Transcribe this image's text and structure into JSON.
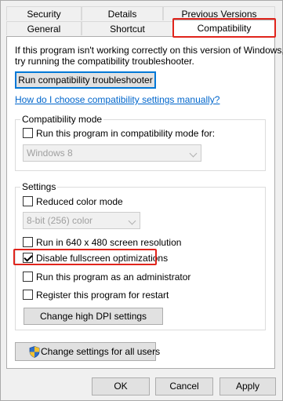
{
  "tabs": {
    "row1": [
      {
        "label": "Security"
      },
      {
        "label": "Details"
      },
      {
        "label": "Previous Versions"
      }
    ],
    "row2": [
      {
        "label": "General"
      },
      {
        "label": "Shortcut"
      },
      {
        "label": "Compatibility"
      }
    ]
  },
  "main": {
    "intro_line1": "If this program isn't working correctly on this version of Windows,",
    "intro_line2": "try running the compatibility troubleshooter.",
    "troubleshooter_button": "Run compatibility troubleshooter",
    "manual_link": "How do I choose compatibility settings manually?",
    "compat_mode": {
      "title": "Compatibility mode",
      "checkbox_label": "Run this program in compatibility mode for:",
      "checked": false,
      "select_value": "Windows 8"
    },
    "settings": {
      "title": "Settings",
      "reduced_color": {
        "label": "Reduced color mode",
        "checked": false
      },
      "color_select_value": "8-bit (256) color",
      "run_640": {
        "label": "Run in 640 x 480 screen resolution",
        "checked": false
      },
      "disable_fullscreen": {
        "label": "Disable fullscreen optimizations",
        "checked": true
      },
      "run_admin": {
        "label": "Run this program as an administrator",
        "checked": false
      },
      "register_restart": {
        "label": "Register this program for restart",
        "checked": false
      },
      "dpi_button": "Change high DPI settings"
    },
    "all_users_button": "Change settings for all users",
    "shield_icon": "uac-shield-icon"
  },
  "footer": {
    "ok": "OK",
    "cancel": "Cancel",
    "apply": "Apply"
  },
  "colors": {
    "highlight_red": "#e0241c",
    "link_blue": "#0066cc",
    "button_gray": "#e1e1e1"
  }
}
